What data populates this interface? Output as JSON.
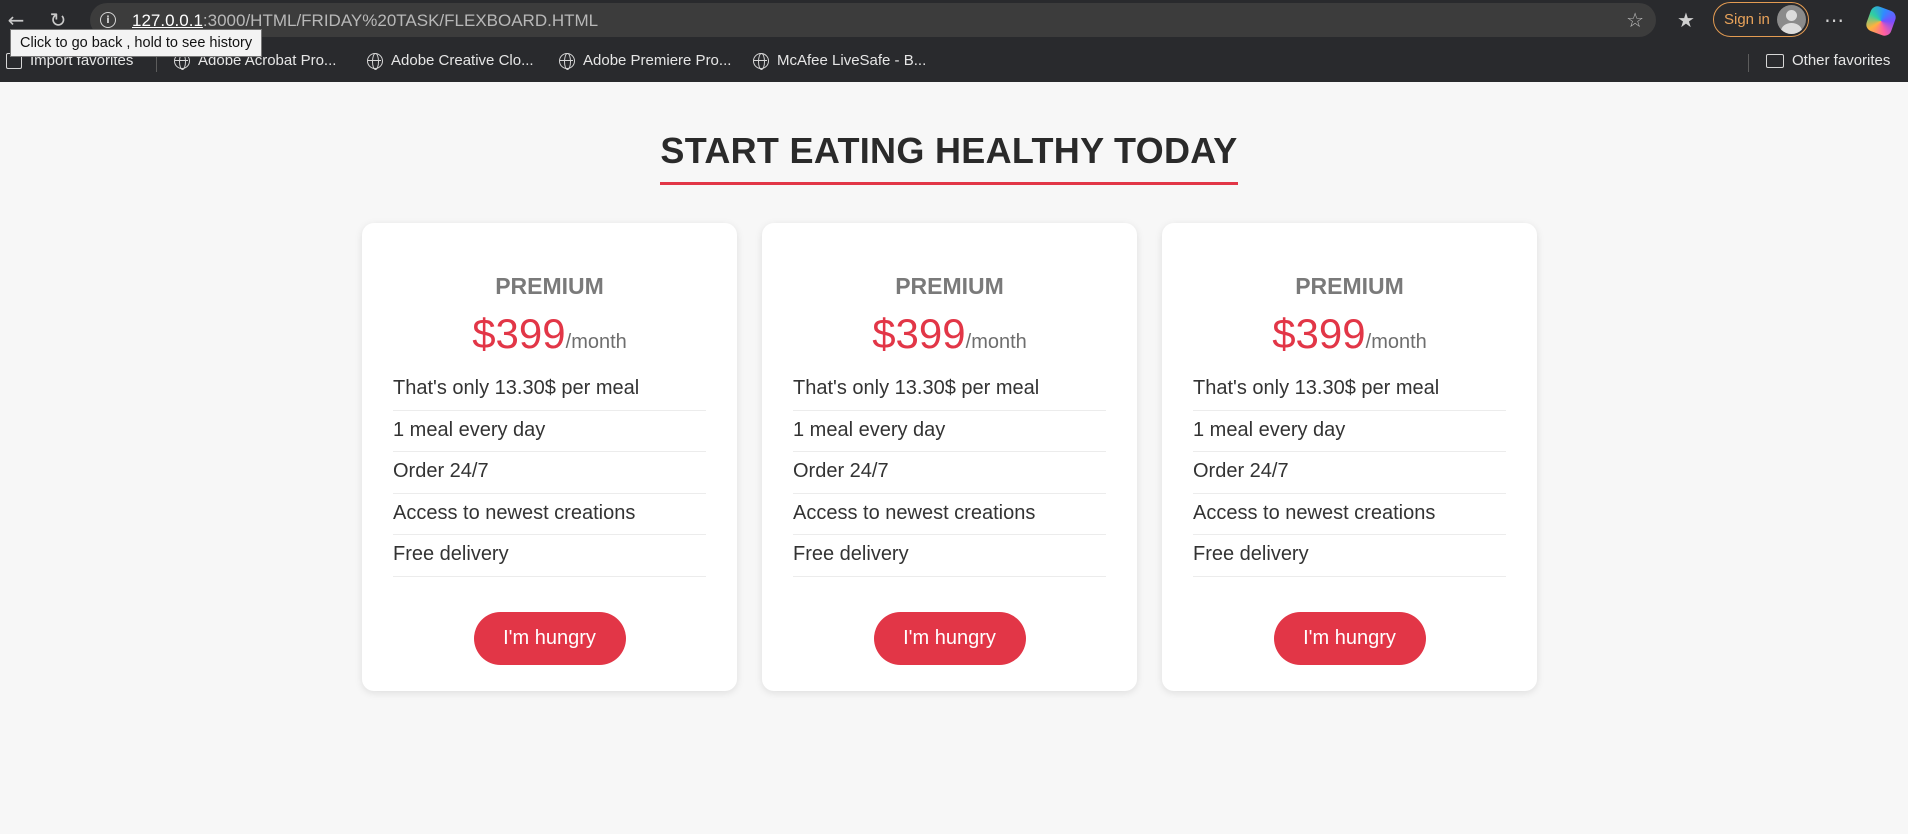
{
  "browser": {
    "url_host": "127.0.0.1",
    "url_rest": ":3000/HTML/FRIDAY%20TASK/FLEXBOARD.HTML",
    "sign_in_label": "Sign in",
    "tooltip": "Click to go back , hold to see history",
    "icons": {
      "back": "back-arrow-icon",
      "refresh": "refresh-icon",
      "info": "info-icon",
      "favorite": "star-icon",
      "favorites": "favorites-icon",
      "more": "more-icon",
      "copilot": "copilot-icon"
    },
    "bookmarks": [
      {
        "label": "Import favorites"
      },
      {
        "label": "Adobe Acrobat Pro..."
      },
      {
        "label": "Adobe Creative Clo..."
      },
      {
        "label": "Adobe Premiere Pro..."
      },
      {
        "label": "McAfee LiveSafe - B..."
      }
    ],
    "other_favorites": "Other favorites"
  },
  "page": {
    "title": "START EATING HEALTHY TODAY",
    "accent_color": "#e23647",
    "cards": [
      {
        "plan": "PREMIUM",
        "price": "$399",
        "period": "/month",
        "features": [
          "That's only 13.30$ per meal",
          "1 meal every day",
          "Order 24/7",
          "Access to newest creations",
          "Free delivery"
        ],
        "button": "I'm hungry"
      },
      {
        "plan": "PREMIUM",
        "price": "$399",
        "period": "/month",
        "features": [
          "That's only 13.30$ per meal",
          "1 meal every day",
          "Order 24/7",
          "Access to newest creations",
          "Free delivery"
        ],
        "button": "I'm hungry"
      },
      {
        "plan": "PREMIUM",
        "price": "$399",
        "period": "/month",
        "features": [
          "That's only 13.30$ per meal",
          "1 meal every day",
          "Order 24/7",
          "Access to newest creations",
          "Free delivery"
        ],
        "button": "I'm hungry"
      }
    ]
  }
}
